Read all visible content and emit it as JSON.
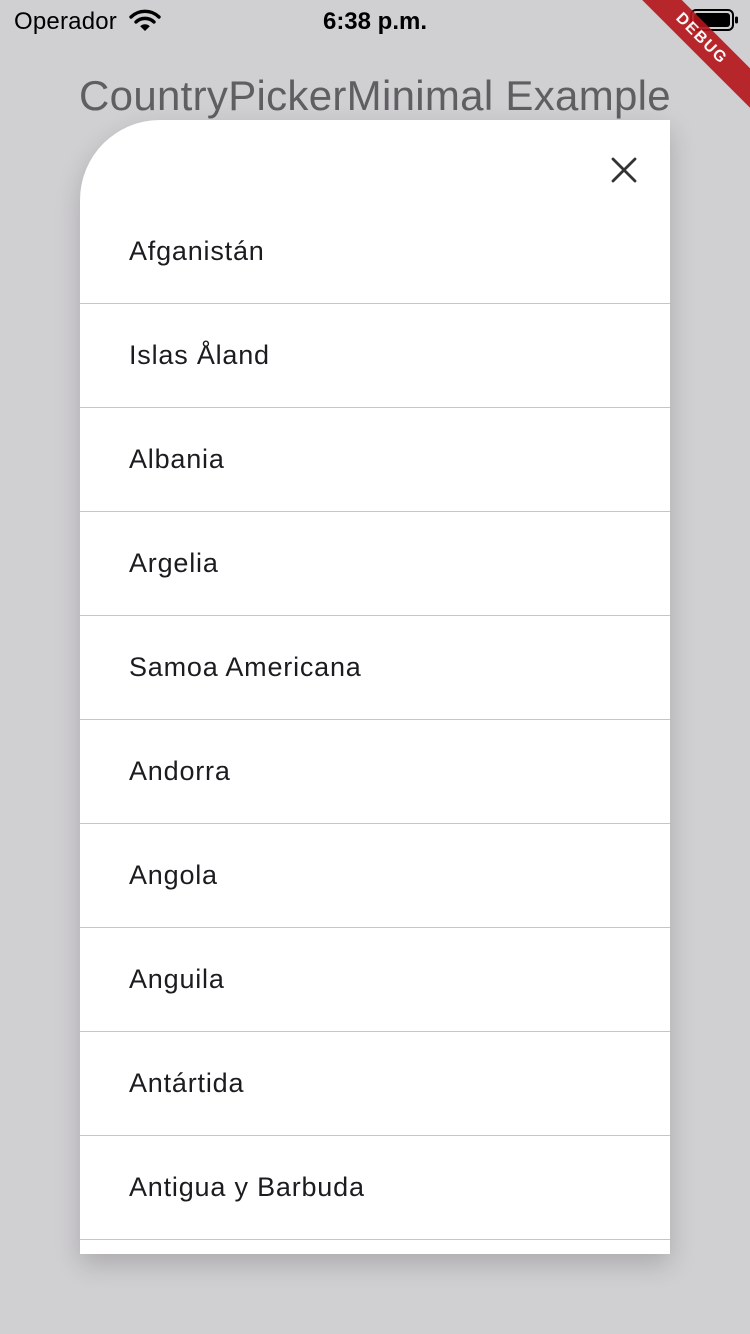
{
  "status_bar": {
    "carrier": "Operador",
    "time": "6:38 p.m.",
    "wifi_icon": "wifi-icon",
    "battery_icon": "battery-icon"
  },
  "debug_banner": {
    "label": "DEBUG",
    "color": "#b4141a"
  },
  "app": {
    "title": "CountryPickerMinimal Example"
  },
  "picker": {
    "close_icon": "close-icon",
    "countries": [
      {
        "name": "Afganistán"
      },
      {
        "name": "Islas Åland"
      },
      {
        "name": "Albania"
      },
      {
        "name": "Argelia"
      },
      {
        "name": "Samoa Americana"
      },
      {
        "name": "Andorra"
      },
      {
        "name": "Angola"
      },
      {
        "name": "Anguila"
      },
      {
        "name": "Antártida"
      },
      {
        "name": "Antigua y Barbuda"
      }
    ]
  },
  "colors": {
    "background": "#d0cfd2",
    "sheet": "#ffffff",
    "divider": "#c6c6c8",
    "text": "#1c1b1f",
    "title": "#5f5e61"
  }
}
